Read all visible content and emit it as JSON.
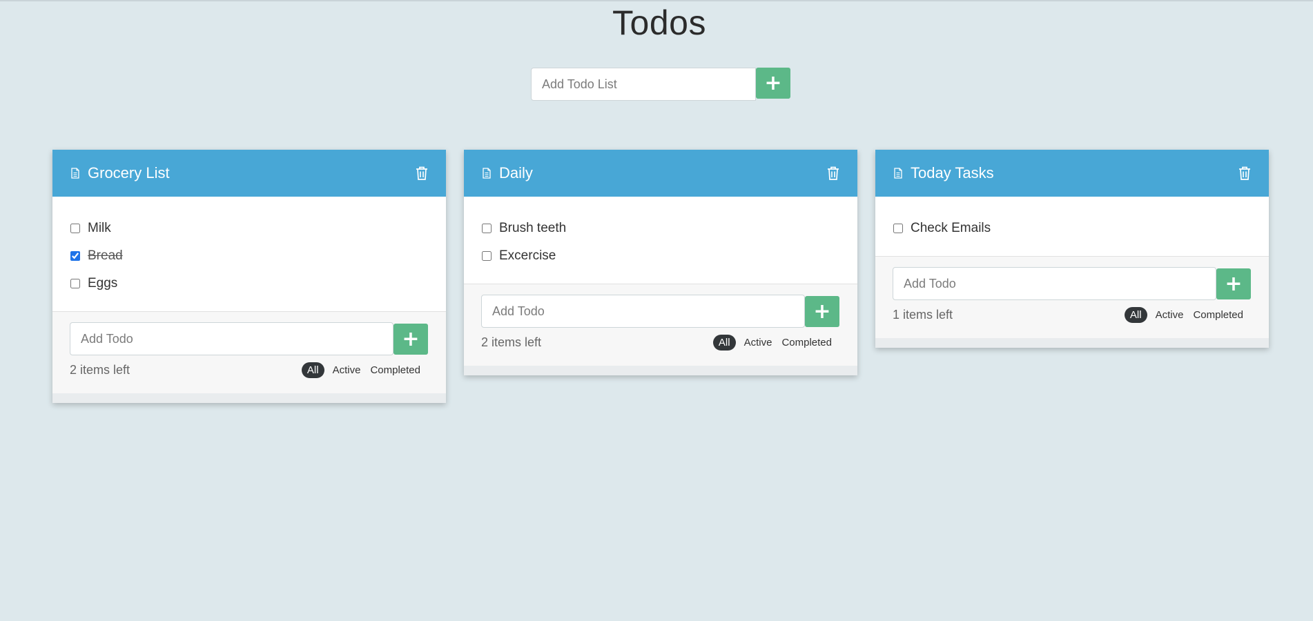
{
  "title": "Todos",
  "new_list": {
    "placeholder": "Add Todo List",
    "button": "+"
  },
  "lists": [
    {
      "name": "Grocery List",
      "items": [
        {
          "text": "Milk",
          "done": false
        },
        {
          "text": "Bread",
          "done": true
        },
        {
          "text": "Eggs",
          "done": false
        }
      ],
      "add_placeholder": "Add Todo",
      "add_button": "+",
      "items_left": "2 items left",
      "filters": [
        "All",
        "Active",
        "Completed"
      ]
    },
    {
      "name": "Daily",
      "items": [
        {
          "text": "Brush teeth",
          "done": false
        },
        {
          "text": "Excercise",
          "done": false
        }
      ],
      "add_placeholder": "Add Todo",
      "add_button": "+",
      "items_left": "2 items left",
      "filters": [
        "All",
        "Active",
        "Completed"
      ]
    },
    {
      "name": "Today Tasks",
      "items": [
        {
          "text": "Check Emails",
          "done": false
        }
      ],
      "add_placeholder": "Add Todo",
      "add_button": "+",
      "items_left": "1 items left",
      "filters": [
        "All",
        "Active",
        "Completed"
      ]
    }
  ],
  "colors": {
    "header": "#48a7d6",
    "add_button": "#5cb888",
    "background": "#dde8ec"
  },
  "icons": {
    "list_icon": "file-text-icon",
    "delete_icon": "trash-icon"
  }
}
